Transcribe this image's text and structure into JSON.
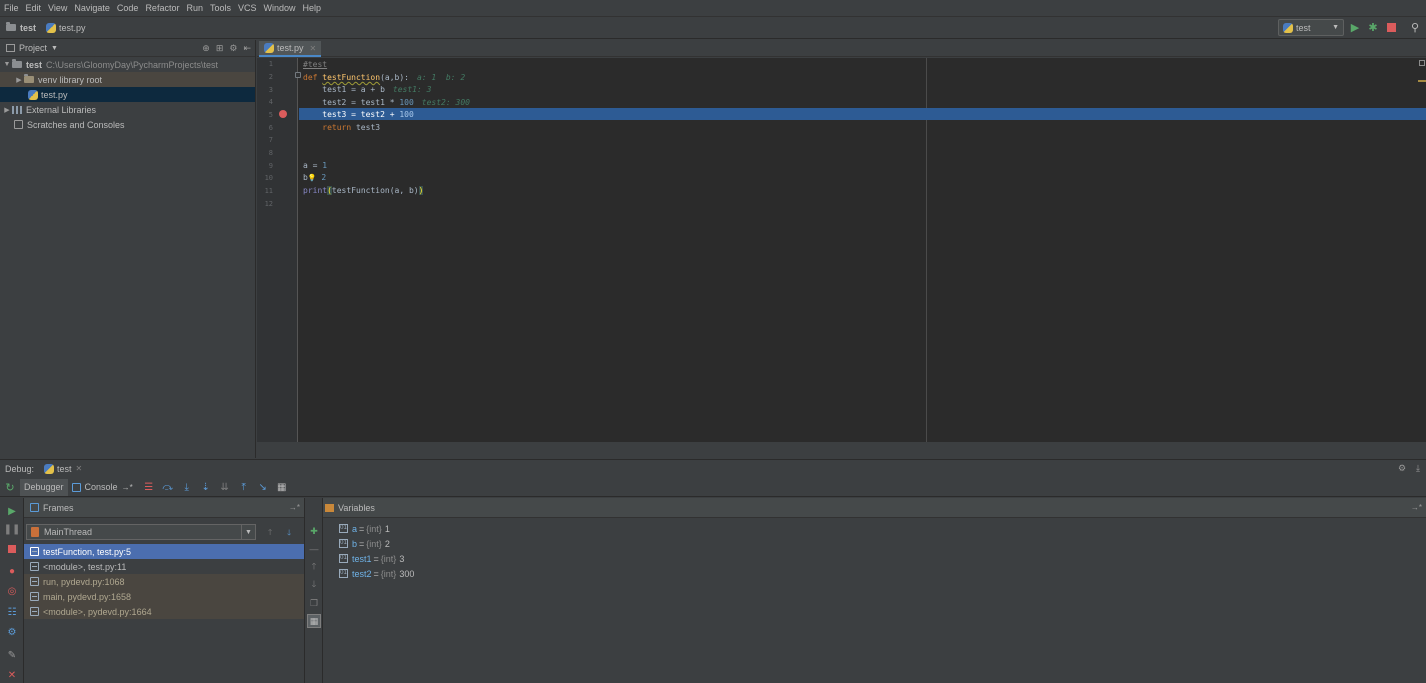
{
  "menu": [
    "File",
    "Edit",
    "View",
    "Navigate",
    "Code",
    "Refactor",
    "Run",
    "Tools",
    "VCS",
    "Window",
    "Help"
  ],
  "nav": {
    "project": "test",
    "file": "test.py"
  },
  "run_config": {
    "name": "test"
  },
  "project_panel": {
    "title": "Project",
    "root": {
      "name": "test",
      "path": "C:\\Users\\GloomyDay\\PycharmProjects\\test"
    },
    "venv": "venv library root",
    "file": "test.py",
    "external": "External Libraries",
    "scratches": "Scratches and Consoles"
  },
  "editor": {
    "tab": "test.py",
    "line_numbers": [
      "1",
      "2",
      "3",
      "4",
      "5",
      "6",
      "7",
      "8",
      "9",
      "10",
      "11",
      "12"
    ],
    "lines": {
      "l1": "#test",
      "l2_kw": "def ",
      "l2_fn": "testFunction",
      "l2_args": "(a,b):",
      "l2_hint": "a: 1  b: 2",
      "l3": "    test1 = a + b",
      "l3_hint": "test1: 3",
      "l4_a": "    test2 = test1 * ",
      "l4_num": "100",
      "l4_hint": "test2: 300",
      "l5_a": "    test3 = test2 + ",
      "l5_num": "100",
      "l6_kw": "    return",
      "l6_b": " test3",
      "l9_a": "a = ",
      "l9_num": "1",
      "l10_a": "b",
      "l10_bulb": "💡",
      "l10_num": " 2",
      "l11_fn": "print",
      "l11_open": "(",
      "l11_mid": "testFunction(a, b)",
      "l11_close": ")"
    }
  },
  "debug": {
    "label": "Debug:",
    "tab": "test",
    "tabs": {
      "debugger": "Debugger",
      "console": "Console"
    },
    "frames_title": "Frames",
    "thread": "MainThread",
    "frames": [
      "testFunction, test.py:5",
      "<module>, test.py:11",
      "run, pydevd.py:1068",
      "main, pydevd.py:1658",
      "<module>, pydevd.py:1664"
    ],
    "variables_title": "Variables",
    "variables": [
      {
        "name": "a",
        "type": "{int}",
        "value": "1"
      },
      {
        "name": "b",
        "type": "{int}",
        "value": "2"
      },
      {
        "name": "test1",
        "type": "{int}",
        "value": "3"
      },
      {
        "name": "test2",
        "type": "{int}",
        "value": "300"
      }
    ]
  },
  "colors": {
    "bg": "#3c3f41",
    "editor_bg": "#2b2b2b",
    "exec_line": "#2d5b94",
    "selection": "#4b6eaf",
    "keyword": "#cc7832",
    "function": "#ffc66d"
  }
}
